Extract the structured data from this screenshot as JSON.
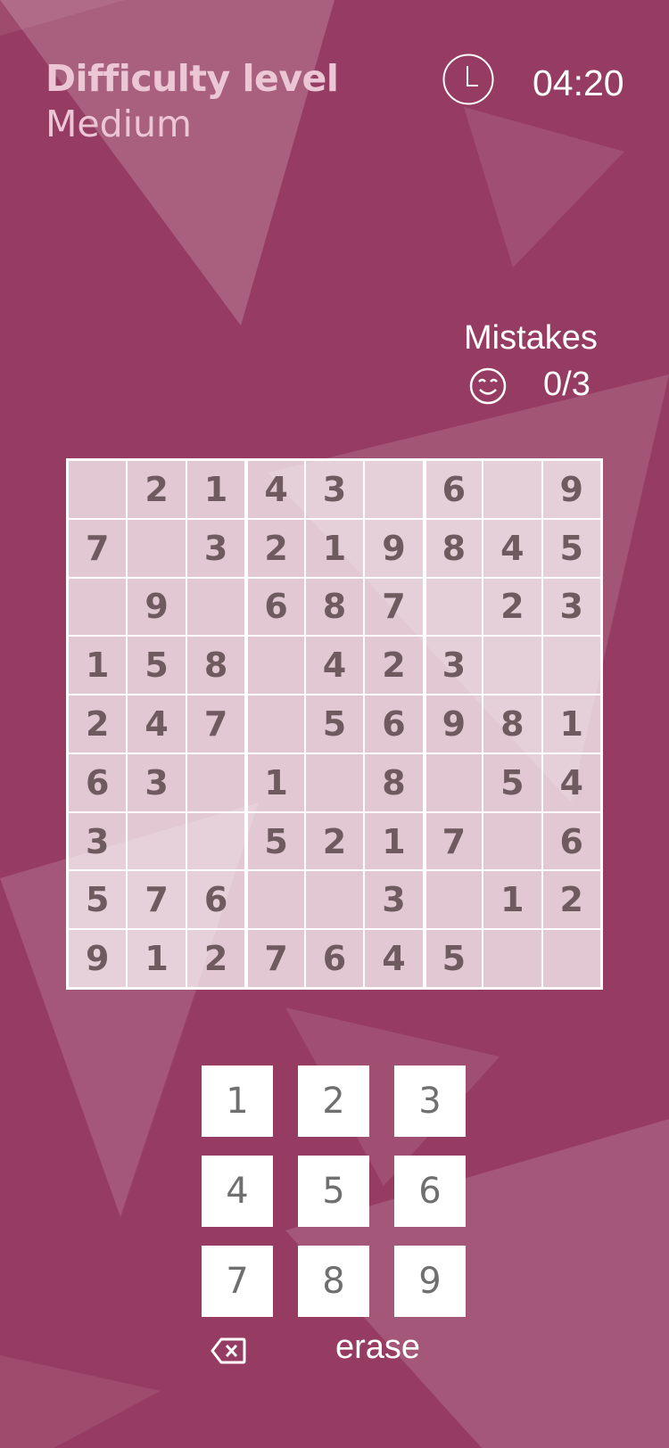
{
  "header": {
    "difficulty_title": "Difficulty level",
    "difficulty_value": "Medium",
    "clock_icon": "clock-icon",
    "timer": "04:20"
  },
  "mistakes": {
    "label": "Mistakes",
    "icon": "smiley-icon",
    "count": "0/3"
  },
  "board": [
    [
      "",
      "2",
      "1",
      "4",
      "3",
      "",
      "6",
      "",
      "9"
    ],
    [
      "7",
      "",
      "3",
      "2",
      "1",
      "9",
      "8",
      "4",
      "5"
    ],
    [
      "",
      "9",
      "",
      "6",
      "8",
      "7",
      "",
      "2",
      "3"
    ],
    [
      "1",
      "5",
      "8",
      "",
      "4",
      "2",
      "3",
      "",
      ""
    ],
    [
      "2",
      "4",
      "7",
      "",
      "5",
      "6",
      "9",
      "8",
      "1"
    ],
    [
      "6",
      "3",
      "",
      "1",
      "",
      "8",
      "",
      "5",
      "4"
    ],
    [
      "3",
      "",
      "",
      "5",
      "2",
      "1",
      "7",
      "",
      "6"
    ],
    [
      "5",
      "7",
      "6",
      "",
      "",
      "3",
      "",
      "1",
      "2"
    ],
    [
      "9",
      "1",
      "2",
      "7",
      "6",
      "4",
      "5",
      "",
      ""
    ]
  ],
  "keypad": {
    "keys": [
      "1",
      "2",
      "3",
      "4",
      "5",
      "6",
      "7",
      "8",
      "9"
    ],
    "backspace_icon": "backspace-icon",
    "erase_label": "erase"
  },
  "colors": {
    "background": "#963c62",
    "cell": "#e0c3d1",
    "digit": "#6f5a60",
    "key_text": "#6f6f6f"
  }
}
